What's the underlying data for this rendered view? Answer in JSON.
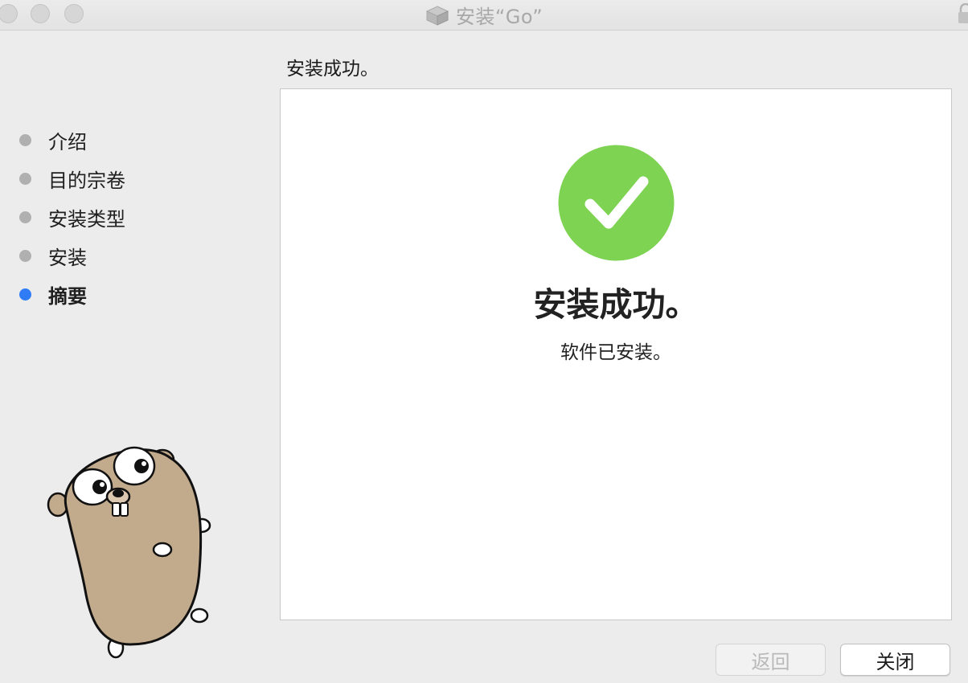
{
  "window": {
    "title": "安装“Go”"
  },
  "header": {
    "title": "安装成功。"
  },
  "sidebar": {
    "steps": [
      {
        "label": "介绍",
        "state": "done"
      },
      {
        "label": "目的宗卷",
        "state": "done"
      },
      {
        "label": "安装类型",
        "state": "done"
      },
      {
        "label": "安装",
        "state": "done"
      },
      {
        "label": "摘要",
        "state": "current"
      }
    ]
  },
  "main": {
    "status_icon": "checkmark-circle-icon",
    "success_title": "安装成功。",
    "success_subtitle": "软件已安装。"
  },
  "buttons": {
    "back_label": "返回",
    "close_label": "关闭"
  },
  "colors": {
    "success_green": "#7ed353",
    "active_step_blue": "#2f7cf6",
    "inactive_step_gray": "#b0b0b0"
  },
  "icons": {
    "title_icon": "package-icon",
    "lock": "lock-icon",
    "mascot": "go-gopher-mascot"
  }
}
